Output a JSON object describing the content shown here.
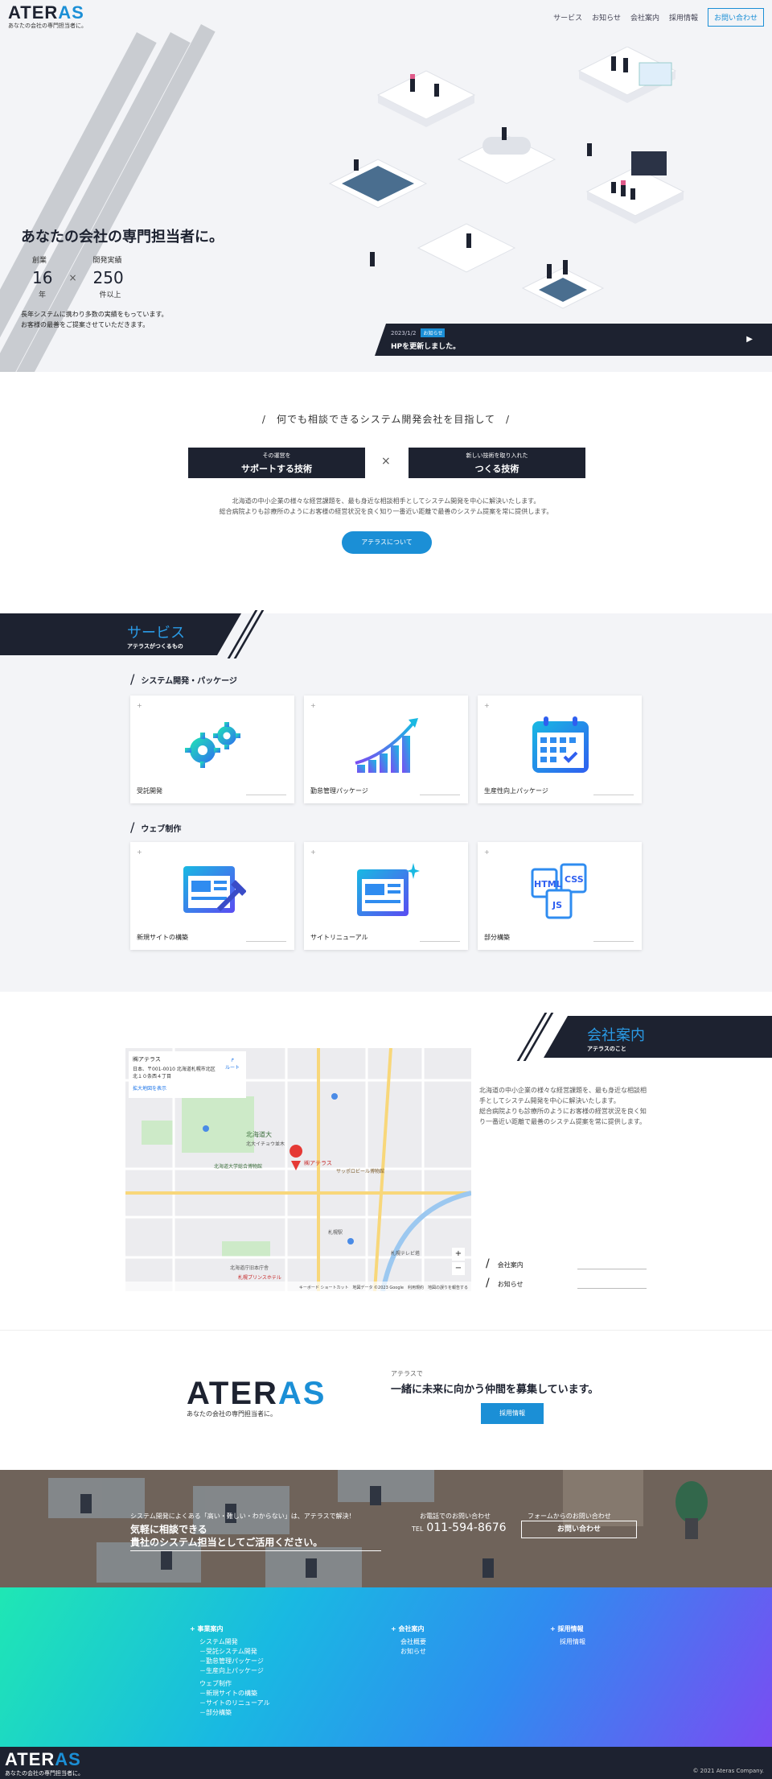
{
  "header": {
    "logo_main": "ATER",
    "logo_accent": "AS",
    "tagline": "あなたの会社の専門担当者に。",
    "nav": [
      "サービス",
      "お知らせ",
      "会社案内",
      "採用情報"
    ],
    "contact": "お問い合わせ"
  },
  "hero": {
    "catch": "あなたの会社の専門担当者に。",
    "stats": [
      {
        "label": "創業",
        "value": "16",
        "unit": "年"
      },
      {
        "label": "開発実績",
        "value": "250",
        "unit": "件以上"
      }
    ],
    "times": "×",
    "note_line1": "長年システムに携わり多数の実績をもっています。",
    "note_line2": "お客様の最善をご提案させていただきます。",
    "news": {
      "date": "2023/1/2",
      "badge": "お知らせ",
      "title": "HPを更新しました。"
    }
  },
  "intro": {
    "heading": "/　何でも相談できるシステム開発会社を目指して　/",
    "left_small": "その運営を",
    "left_big": "サポートする技術",
    "times": "×",
    "right_small": "新しい技術を取り入れた",
    "right_big": "つくる技術",
    "text_line1": "北海道の中小企業の様々な経営課題を、最も身近な相談相手としてシステム開発を中心に解決いたします。",
    "text_line2": "総合病院よりも診療所のようにお客様の経営状況を良く知り一番近い距離で最善のシステム提案を常に提供します。",
    "button": "アテラスについて"
  },
  "services": {
    "title": "サービス",
    "subtitle": "アテラスがつくるもの",
    "groups": [
      {
        "label": "システム開発・パッケージ",
        "cards": [
          "受託開発",
          "勤怠管理パッケージ",
          "生産性向上パッケージ"
        ]
      },
      {
        "label": "ウェブ制作",
        "cards": [
          "新規サイトの構築",
          "サイトリニューアル",
          "部分構築"
        ]
      }
    ]
  },
  "company": {
    "title": "会社案内",
    "subtitle": "アテラスのこと",
    "text_line1": "北海道の中小企業の様々な経営課題を、最も身近な相談相",
    "text_line2": "手としてシステム開発を中心に解決いたします。",
    "text_line3": "総合病院よりも診療所のようにお客様の経営状況を良く知",
    "text_line4": "り一番近い距離で最善のシステム提案を常に提供します。",
    "links": [
      "会社案内",
      "お知らせ"
    ],
    "map": {
      "place": "㈱アテラス",
      "address1": "日本、〒001-0010 北海道札幌市北区",
      "address2": "北１０条西４丁目",
      "route": "ルート",
      "enlarge": "拡大地図を表示",
      "pin": "㈱アテラス",
      "l1": "北海道大",
      "l2": "北大イチョウ並木",
      "l3": "北海道大学総合博物館",
      "l4": "サッポロビール博物館",
      "l5": "札幌駅",
      "l6": "札幌テレビ塔",
      "l7": "北海道庁旧本庁舎",
      "l8": "札幌プリンスホテル",
      "footer": "キーボード ショートカット　地図データ ©2023 Google　利用規約　地図の誤りを報告する"
    }
  },
  "recruit": {
    "logo_main": "ATER",
    "logo_accent": "AS",
    "tagline": "あなたの会社の専門担当者に。",
    "small": "アテラスで",
    "heading": "一緒に未来に向かう仲間を募集しています。",
    "button": "採用情報"
  },
  "cta": {
    "small": "システム開発によくある「高い・難しい・わからない」は、アテラスで解決！",
    "big_line1": "気軽に相談できる",
    "big_line2": "貴社のシステム担当としてご活用ください。",
    "phone_label": "お電話でのお問い合わせ",
    "tel_label": "TEL",
    "phone": "011-594-8676",
    "form_label": "フォームからのお問い合わせ",
    "form_button": "お問い合わせ"
  },
  "footer": {
    "col1": {
      "head": "+ 事業案内",
      "items": [
        "システム開発",
        "－受託システム開発",
        "－勤怠管理パッケージ",
        "－生産向上パッケージ",
        "ウェブ制作",
        "－新規サイトの構築",
        "－サイトのリニューアル",
        "－部分構築"
      ]
    },
    "col2": {
      "head": "+ 会社案内",
      "items": [
        "会社概要",
        "お知らせ"
      ]
    },
    "col3": {
      "head": "+ 採用情報",
      "items": [
        "採用情報"
      ]
    },
    "logo_main": "ATER",
    "logo_accent": "AS",
    "tagline": "あなたの会社の専門担当者に。",
    "copyright": "© 2021 Ateras Company."
  }
}
